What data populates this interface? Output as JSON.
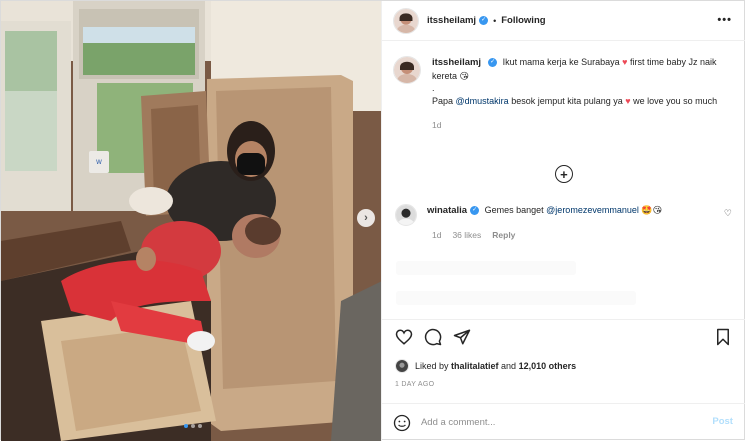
{
  "post": {
    "username": "itssheilamj",
    "follow_label": "Following",
    "dot_sep": "•",
    "more_label": "•••",
    "caption_part1": "Ikut mama kerja ke Surabaya",
    "caption_part2": "first time baby Jz naik kereta",
    "caption_dot": ".",
    "caption_line2_a": "Papa",
    "caption_mention": "@dmustakira",
    "caption_line2_b": "besok jemput kita pulang ya",
    "caption_line2_c": "we love you so much",
    "caption_time": "1d",
    "heart_emoji": "♥",
    "wink_emoji": "😘"
  },
  "load_more": {
    "icon": "plus-circle-icon",
    "label": "+"
  },
  "comment": {
    "username": "winatalia",
    "text": "Gemes banget",
    "mention": "@jeromezevemmanuel",
    "emojis": "🤩😘",
    "time": "1d",
    "likes": "36 likes",
    "reply": "Reply"
  },
  "actions": {
    "like_icon": "heart-icon",
    "comment_icon": "comment-bubble-icon",
    "share_icon": "paper-plane-icon",
    "save_icon": "bookmark-icon"
  },
  "likes": {
    "liked_by": "Liked by",
    "user": "thalitalatief",
    "and": "and",
    "others": "12,010 others"
  },
  "timestamp": "1 DAY AGO",
  "composer": {
    "placeholder": "Add a comment...",
    "post_label": "Post",
    "emoji_icon": "smiley-icon"
  },
  "carousel": {
    "next_icon": "chevron-right-icon",
    "next_label": "›",
    "count": 3,
    "active": 1
  },
  "colors": {
    "accent": "#3897f0",
    "heart": "#ed4956",
    "link": "#00376b",
    "muted": "#8e8e8e"
  }
}
